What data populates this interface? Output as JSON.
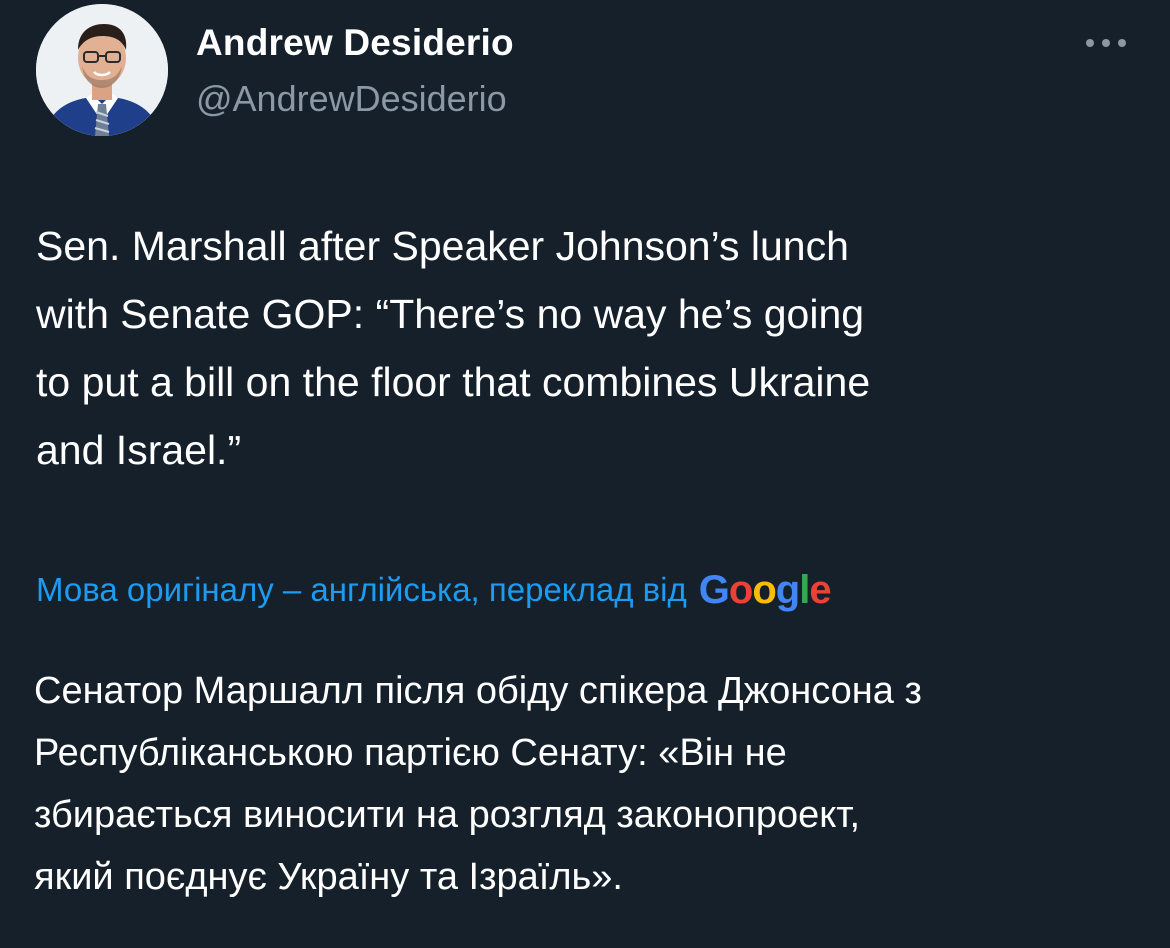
{
  "author": {
    "display_name": "Andrew Desiderio",
    "handle": "@AndrewDesiderio"
  },
  "tweet": {
    "lines": [
      "Sen. Marshall after Speaker Johnson’s lunch",
      "with Senate GOP: “There’s no way he’s going",
      "to put a bill on the floor that combines Ukraine",
      "and Israel.”"
    ]
  },
  "translation": {
    "label": "Мова оригіналу – англійська, переклад від",
    "provider_letters": [
      "G",
      "o",
      "o",
      "g",
      "l",
      "e"
    ],
    "provider_colors": [
      "#4285f4",
      "#ea4335",
      "#fbbc05",
      "#4285f4",
      "#34a853",
      "#ea4335"
    ],
    "lines": [
      "Сенатор Маршалл після обіду спікера Джонсона з",
      "Республіканською партією Сенату: «Він не",
      "збирається виносити на розгляд законопроект,",
      "який поєднує Україну та Ізраїль»."
    ]
  },
  "icons": {
    "more": "more-horizontal-icon"
  },
  "colors": {
    "background": "#15202b",
    "secondary_text": "#8b98a5",
    "link": "#1d9bf0"
  }
}
